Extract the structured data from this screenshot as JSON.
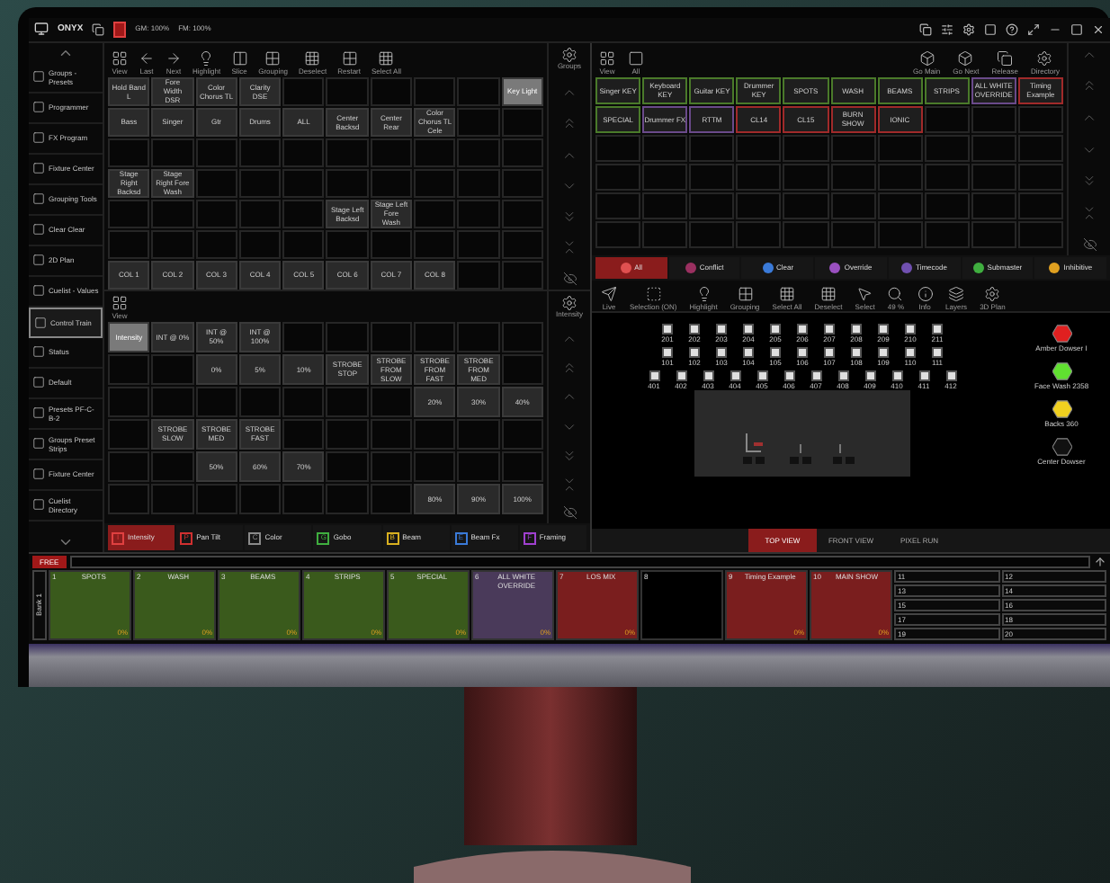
{
  "top_bar": {
    "app": "ONYX",
    "gm": "GM: 100%",
    "fm": "FM: 100%"
  },
  "sidebar": {
    "items": [
      {
        "label": "Groups - Presets",
        "selected": false
      },
      {
        "label": "Programmer",
        "selected": false
      },
      {
        "label": "FX Program",
        "selected": false
      },
      {
        "label": "Fixture Center",
        "selected": false
      },
      {
        "label": "Grouping Tools",
        "selected": false
      },
      {
        "label": "Clear Clear",
        "selected": false
      },
      {
        "label": "2D Plan",
        "selected": false
      },
      {
        "label": "Cuelist - Values",
        "selected": false
      },
      {
        "label": "Control Train",
        "selected": true
      },
      {
        "label": "Status",
        "selected": false
      },
      {
        "label": "Default",
        "selected": false
      },
      {
        "label": "Presets PF-C-B-2",
        "selected": false
      },
      {
        "label": "Groups Preset Strips",
        "selected": false
      },
      {
        "label": "Fixture Center",
        "selected": false
      },
      {
        "label": "Cuelist Directory",
        "selected": false
      }
    ]
  },
  "groups": {
    "toolbar": [
      "View",
      "Last",
      "Next",
      "Highlight",
      "Slice",
      "Grouping",
      "Deselect",
      "Restart",
      "Select All"
    ],
    "side_label": "Groups",
    "cells": [
      {
        "label": "Hold Band L",
        "selected": false
      },
      {
        "label": "Fore Width DSR",
        "selected": false
      },
      {
        "label": "Color Chorus TL",
        "selected": false
      },
      {
        "label": "Clarity DSE",
        "selected": false
      },
      null,
      null,
      null,
      null,
      null,
      {
        "label": "Key Light",
        "selected": true
      },
      {
        "label": "Bass",
        "selected": false
      },
      {
        "label": "Singer",
        "selected": false
      },
      {
        "label": "Gtr",
        "selected": false
      },
      {
        "label": "Drums",
        "selected": false
      },
      {
        "label": "ALL",
        "selected": false
      },
      {
        "label": "Center Backsd",
        "selected": false
      },
      {
        "label": "Center Rear",
        "selected": false
      },
      {
        "label": "Color Chorus TL Cele",
        "selected": false
      },
      null,
      null,
      null,
      null,
      null,
      null,
      null,
      null,
      null,
      null,
      null,
      null,
      {
        "label": "Stage Right Backsd",
        "selected": false
      },
      {
        "label": "Stage Right Fore Wash",
        "selected": false
      },
      null,
      null,
      null,
      null,
      null,
      null,
      null,
      null,
      null,
      null,
      null,
      null,
      null,
      {
        "label": "Stage Left Backsd",
        "selected": false
      },
      {
        "label": "Stage Left Fore Wash",
        "selected": false
      },
      null,
      null,
      null,
      null,
      null,
      null,
      null,
      null,
      null,
      null,
      null,
      null,
      null,
      {
        "label": "COL 1",
        "selected": false
      },
      {
        "label": "COL 2",
        "selected": false
      },
      {
        "label": "COL 3",
        "selected": false
      },
      {
        "label": "COL 4",
        "selected": false
      },
      {
        "label": "COL 5",
        "selected": false
      },
      {
        "label": "COL 6",
        "selected": false
      },
      {
        "label": "COL 7",
        "selected": false
      },
      {
        "label": "COL 8",
        "selected": false
      },
      null,
      null
    ]
  },
  "presets": {
    "toolbar": [
      "View"
    ],
    "side_label": "Intensity",
    "cells": [
      {
        "label": "Intensity",
        "selected": true
      },
      {
        "label": "INT @ 0%",
        "selected": false
      },
      {
        "label": "INT @ 50%",
        "selected": false
      },
      {
        "label": "INT @ 100%",
        "selected": false
      },
      null,
      null,
      null,
      null,
      null,
      null,
      null,
      null,
      {
        "label": "0%",
        "selected": false
      },
      {
        "label": "5%",
        "selected": false
      },
      {
        "label": "10%",
        "selected": false
      },
      {
        "label": "STROBE STOP",
        "selected": false
      },
      {
        "label": "STROBE FROM SLOW",
        "selected": false
      },
      {
        "label": "STROBE FROM FAST",
        "selected": false
      },
      {
        "label": "STROBE FROM MED",
        "selected": false
      },
      null,
      null,
      null,
      null,
      null,
      null,
      null,
      null,
      {
        "label": "20%",
        "selected": false
      },
      {
        "label": "30%",
        "selected": false
      },
      {
        "label": "40%",
        "selected": false
      },
      null,
      {
        "label": "STROBE SLOW",
        "selected": false
      },
      {
        "label": "STROBE MED",
        "selected": false
      },
      {
        "label": "STROBE FAST",
        "selected": false
      },
      null,
      null,
      null,
      null,
      null,
      null,
      null,
      null,
      {
        "label": "50%",
        "selected": false
      },
      {
        "label": "60%",
        "selected": false
      },
      {
        "label": "70%",
        "selected": false
      },
      null,
      null,
      null,
      null,
      null,
      null,
      null,
      null,
      null,
      null,
      null,
      null,
      {
        "label": "80%",
        "selected": false
      },
      {
        "label": "90%",
        "selected": false
      },
      {
        "label": "100%",
        "selected": false
      }
    ],
    "features": [
      {
        "key": "I",
        "label": "Intensity",
        "color": "#e04040",
        "selected": true
      },
      {
        "key": "P",
        "label": "Pan Tilt",
        "color": "#d03030",
        "selected": false
      },
      {
        "key": "C",
        "label": "Color",
        "color": "#8a8a8a",
        "selected": false
      },
      {
        "key": "G",
        "label": "Gobo",
        "color": "#3fae3f",
        "selected": false
      },
      {
        "key": "B",
        "label": "Beam",
        "color": "#d8b020",
        "selected": false
      },
      {
        "key": "E",
        "label": "Beam Fx",
        "color": "#3a7ad8",
        "selected": false
      },
      {
        "key": "F",
        "label": "Framing",
        "color": "#a040d0",
        "selected": false
      }
    ]
  },
  "cuelists": {
    "toolbar_left": [
      "View",
      "All"
    ],
    "toolbar_right": [
      "Go Main",
      "Go Next",
      "Release",
      "Directory"
    ],
    "cells": [
      {
        "label": "Singer KEY",
        "color": "#4a7a2a"
      },
      {
        "label": "Keyboard KEY",
        "color": "#4a7a2a"
      },
      {
        "label": "Guitar KEY",
        "color": "#4a7a2a"
      },
      {
        "label": "Drummer KEY",
        "color": "#4a7a2a"
      },
      {
        "label": "SPOTS",
        "color": "#4a7a2a"
      },
      {
        "label": "WASH",
        "color": "#4a7a2a"
      },
      {
        "label": "BEAMS",
        "color": "#4a7a2a"
      },
      {
        "label": "STRIPS",
        "color": "#4a7a2a"
      },
      {
        "label": "ALL WHITE OVERRIDE",
        "color": "#6a4a8a"
      },
      {
        "label": "Timing Example",
        "color": "#a02a2a"
      },
      {
        "label": "SPECIAL",
        "color": "#4a7a2a"
      },
      {
        "label": "Drummer FX",
        "color": "#6a4a8a"
      },
      {
        "label": "RTTM",
        "color": "#6a4a8a"
      },
      {
        "label": "CL14",
        "color": "#a02a2a"
      },
      {
        "label": "CL15",
        "color": "#a02a2a"
      },
      {
        "label": "BURN SHOW",
        "color": "#a02a2a"
      },
      {
        "label": "IONIC",
        "color": "#a02a2a"
      },
      null,
      null,
      null,
      null,
      null,
      null,
      null,
      null,
      null,
      null,
      null,
      null,
      null,
      null,
      null,
      null,
      null,
      null,
      null,
      null,
      null,
      null,
      null,
      null,
      null,
      null,
      null,
      null,
      null,
      null,
      null,
      null,
      null,
      null,
      null,
      null,
      null,
      null,
      null,
      null,
      null,
      null,
      null
    ]
  },
  "modes": [
    {
      "label": "All",
      "color": "#e05050",
      "selected": true
    },
    {
      "label": "Conflict",
      "color": "#9a3060",
      "selected": false
    },
    {
      "label": "Clear",
      "color": "#3a7ad8",
      "selected": false
    },
    {
      "label": "Override",
      "color": "#9a50c0",
      "selected": false
    },
    {
      "label": "Timecode",
      "color": "#7050b0",
      "selected": false
    },
    {
      "label": "Submaster",
      "color": "#3fae3f",
      "selected": false
    },
    {
      "label": "Inhibitive",
      "color": "#e0a020",
      "selected": false
    }
  ],
  "plan": {
    "toolbar": [
      "Live",
      "Selection (ON)",
      "Highlight",
      "Grouping",
      "Select All",
      "Deselect",
      "Select",
      "49 %",
      "Info",
      "Layers",
      "3D Plan"
    ],
    "fixture_rows": [
      [
        "201",
        "202",
        "203",
        "204",
        "205",
        "206",
        "207",
        "208",
        "209",
        "210",
        "211"
      ],
      [
        "101",
        "102",
        "103",
        "104",
        "105",
        "106",
        "107",
        "108",
        "109",
        "110",
        "111"
      ],
      [
        "401",
        "402",
        "403",
        "404",
        "405",
        "406",
        "407",
        "408",
        "409",
        "410",
        "411",
        "412"
      ]
    ],
    "legend": [
      {
        "label": "Amber Dowser I",
        "color": "#e02020"
      },
      {
        "label": "Face Wash 2358",
        "color": "#60e030"
      },
      {
        "label": "Backs 360",
        "color": "#f0d020"
      },
      {
        "label": "Center Dowser",
        "color": "#111111"
      }
    ],
    "views": [
      {
        "label": "TOP VIEW",
        "selected": true
      },
      {
        "label": "FRONT VIEW",
        "selected": false
      },
      {
        "label": "PIXEL RUN",
        "selected": false
      }
    ]
  },
  "command_line": {
    "tag": "FREE"
  },
  "playback": {
    "bank": "Bank 1",
    "faders": [
      {
        "number": "1",
        "label": "SPOTS",
        "color": "#3a5a1c",
        "level_text": "0%"
      },
      {
        "number": "2",
        "label": "WASH",
        "color": "#3a5a1c",
        "level_text": "0%"
      },
      {
        "number": "3",
        "label": "BEAMS",
        "color": "#3a5a1c",
        "level_text": "0%"
      },
      {
        "number": "4",
        "label": "STRIPS",
        "color": "#3a5a1c",
        "level_text": "0%"
      },
      {
        "number": "5",
        "label": "SPECIAL",
        "color": "#3a5a1c",
        "level_text": "0%"
      },
      {
        "number": "6",
        "label": "ALL WHITE OVERRIDE",
        "color": "#4a3a5a",
        "level_text": "0%"
      },
      {
        "number": "7",
        "label": "LOS MIX",
        "color": "#7a1e1e",
        "level_text": "0%"
      },
      {
        "number": "8",
        "color": "#000000"
      },
      {
        "number": "9",
        "label": "Timing Example",
        "color": "#7a1e1e",
        "level_text": "0%"
      },
      {
        "number": "10",
        "label": "MAIN SHOW",
        "color": "#7a1e1e",
        "level_text": "0%"
      }
    ],
    "slots": [
      "11",
      "12",
      "13",
      "14",
      "15",
      "16",
      "17",
      "18",
      "19",
      "20"
    ]
  }
}
